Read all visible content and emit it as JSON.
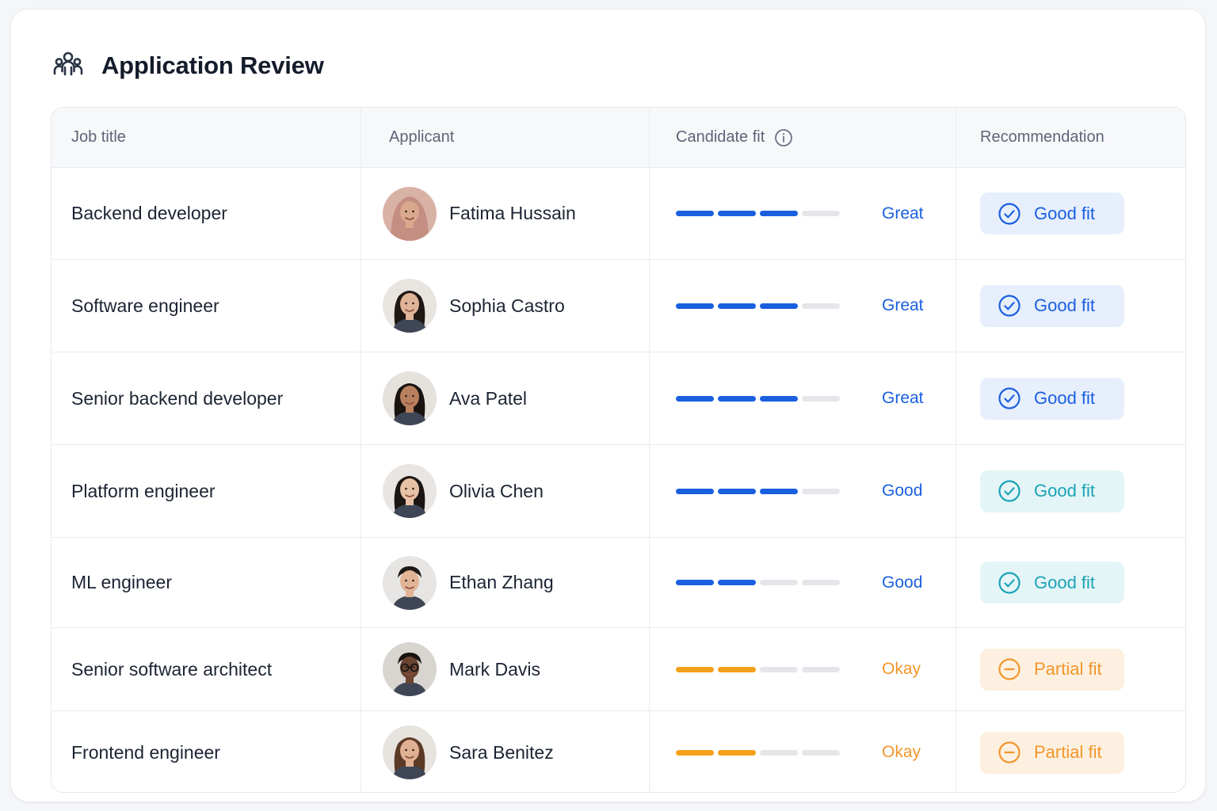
{
  "app": {
    "title": "Application Review",
    "icon": "users-icon"
  },
  "columns": {
    "job_title": "Job title",
    "applicant": "Applicant",
    "candidate_fit": "Candidate fit",
    "recommendation": "Recommendation"
  },
  "colors": {
    "blue": "#1a5fe0",
    "orange": "#f4a01b",
    "teal": "#1aa3b6",
    "empty_segment": "#e4e6ea",
    "good_fit_strong_bg": "#e7effd",
    "good_fit_soft_bg": "#e4f5f7",
    "partial_fit_bg": "#fdf0e0",
    "partial_fit_text": "#f2962b"
  },
  "rows": [
    {
      "job": "Backend developer",
      "applicant": "Fatima Hussain",
      "fit_score": 3,
      "fit_max": 4,
      "fit_label": "Great",
      "tone": "blue",
      "recommendation": "Good fit",
      "rec_type": "strong",
      "rec_icon": "check-circle-icon"
    },
    {
      "job": "Software engineer",
      "applicant": "Sophia Castro",
      "fit_score": 3,
      "fit_max": 4,
      "fit_label": "Great",
      "tone": "blue",
      "recommendation": "Good fit",
      "rec_type": "strong",
      "rec_icon": "check-circle-icon"
    },
    {
      "job": "Senior backend developer",
      "applicant": "Ava Patel",
      "fit_score": 3,
      "fit_max": 4,
      "fit_label": "Great",
      "tone": "blue",
      "recommendation": "Good fit",
      "rec_type": "strong",
      "rec_icon": "check-circle-icon"
    },
    {
      "job": "Platform engineer",
      "applicant": "Olivia Chen",
      "fit_score": 3,
      "fit_max": 4,
      "fit_label": "Good",
      "tone": "blue",
      "recommendation": "Good fit",
      "rec_type": "soft",
      "rec_icon": "check-circle-icon"
    },
    {
      "job": "ML engineer",
      "applicant": "Ethan Zhang",
      "fit_score": 2,
      "fit_max": 4,
      "fit_label": "Good",
      "tone": "blue",
      "recommendation": "Good fit",
      "rec_type": "soft",
      "rec_icon": "check-circle-icon"
    },
    {
      "job": "Senior software architect",
      "applicant": "Mark Davis",
      "fit_score": 2,
      "fit_max": 4,
      "fit_label": "Okay",
      "tone": "orange",
      "recommendation": "Partial fit",
      "rec_type": "partial",
      "rec_icon": "minus-circle-icon"
    },
    {
      "job": "Frontend engineer",
      "applicant": "Sara Benitez",
      "fit_score": 2,
      "fit_max": 4,
      "fit_label": "Okay",
      "tone": "orange",
      "recommendation": "Partial fit",
      "rec_type": "partial",
      "rec_icon": "minus-circle-icon"
    }
  ]
}
